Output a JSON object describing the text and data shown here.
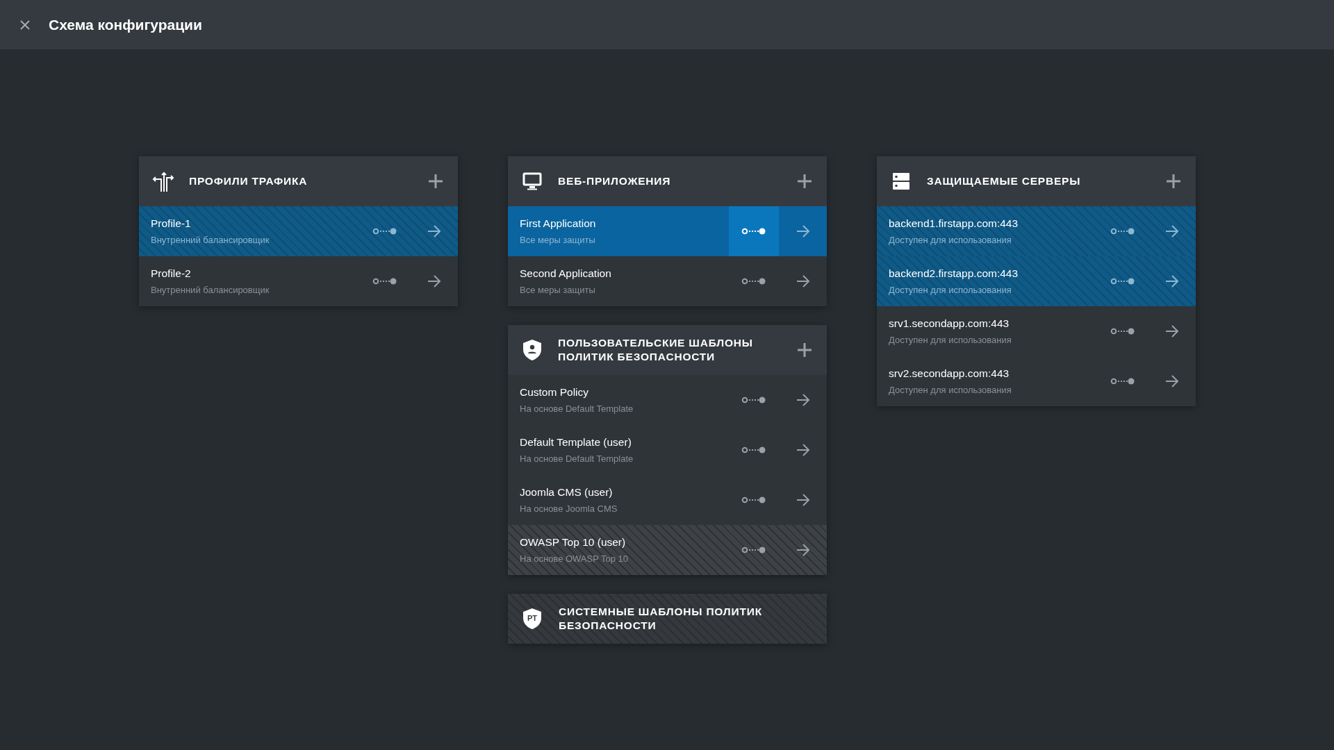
{
  "window": {
    "title": "Схема конфигурации"
  },
  "columns": [
    {
      "panels": [
        {
          "kind": "traffic",
          "title": "ПРОФИЛИ ТРАФИКА",
          "addable": true,
          "rows": [
            {
              "title": "Profile-1",
              "subtitle": "Внутренний балансировщик",
              "linked": true,
              "selected": false,
              "hatched": false
            },
            {
              "title": "Profile-2",
              "subtitle": "Внутренний балансировщик",
              "linked": false,
              "selected": false,
              "hatched": false
            }
          ]
        }
      ]
    },
    {
      "panels": [
        {
          "kind": "apps",
          "title": "ВЕБ-ПРИЛОЖЕНИЯ",
          "addable": true,
          "rows": [
            {
              "title": "First Application",
              "subtitle": "Все меры защиты",
              "linked": false,
              "selected": true,
              "hatched": false
            },
            {
              "title": "Second Application",
              "subtitle": "Все меры защиты",
              "linked": false,
              "selected": false,
              "hatched": false
            }
          ]
        },
        {
          "kind": "custom-policies",
          "title": "ПОЛЬЗОВАТЕЛЬСКИЕ ШАБЛОНЫ ПОЛИТИК БЕЗОПАСНОСТИ",
          "addable": true,
          "rows": [
            {
              "title": "Custom Policy",
              "subtitle": "На основе Default Template",
              "linked": false,
              "selected": false,
              "hatched": false
            },
            {
              "title": "Default Template (user)",
              "subtitle": "На основе Default Template",
              "linked": false,
              "selected": false,
              "hatched": false
            },
            {
              "title": "Joomla CMS (user)",
              "subtitle": "На основе Joomla CMS",
              "linked": false,
              "selected": false,
              "hatched": false
            },
            {
              "title": "OWASP Top 10 (user)",
              "subtitle": "На основе OWASP Top 10",
              "linked": false,
              "selected": false,
              "hatched": true
            }
          ]
        },
        {
          "kind": "system-policies",
          "title": "СИСТЕМНЫЕ ШАБЛОНЫ ПОЛИТИК БЕЗОПАСНОСТИ",
          "badge": "PT",
          "addable": false,
          "hatched": true
        }
      ]
    },
    {
      "panels": [
        {
          "kind": "servers",
          "title": "ЗАЩИЩАЕМЫЕ СЕРВЕРЫ",
          "addable": true,
          "rows": [
            {
              "title": "backend1.firstapp.com:443",
              "subtitle": "Доступен для использования",
              "linked": true,
              "selected": false,
              "hatched": false
            },
            {
              "title": "backend2.firstapp.com:443",
              "subtitle": "Доступен для использования",
              "linked": true,
              "selected": false,
              "hatched": false
            },
            {
              "title": "srv1.secondapp.com:443",
              "subtitle": "Доступен для использования",
              "linked": false,
              "selected": false,
              "hatched": false
            },
            {
              "title": "srv2.secondapp.com:443",
              "subtitle": "Доступен для использования",
              "linked": false,
              "selected": false,
              "hatched": false
            }
          ]
        }
      ]
    }
  ]
}
